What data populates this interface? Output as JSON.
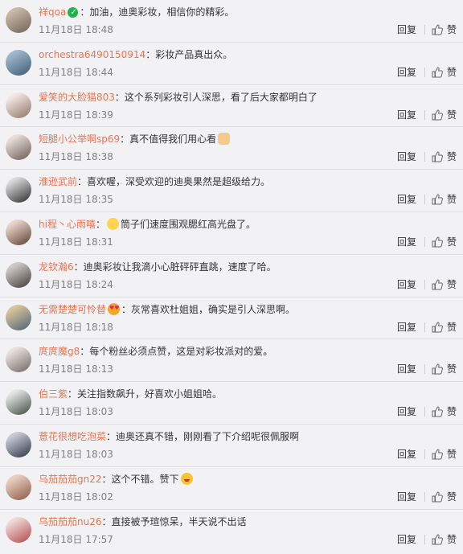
{
  "comments": [
    {
      "user": "祥qoa",
      "badge": true,
      "text": "加油，迪奥彩妆，相信你的精彩。",
      "date": "11月18日 18:48",
      "avatar": [
        "#c8b8a8",
        "#6f6258"
      ]
    },
    {
      "user": "orchestra6490150914",
      "text": "彩妆产品真出众。",
      "date": "11月18日 18:44",
      "avatar": [
        "#9fb7cc",
        "#3d5a73"
      ]
    },
    {
      "user": "爱笑的大脸猫803",
      "text": "这个系列彩妆引人深思，看了后大家都明白了",
      "date": "11月18日 18:39",
      "avatar": [
        "#f1e7e1",
        "#8e7367"
      ]
    },
    {
      "user": "短腿小公举啊sp69",
      "text": "真不值得我们用心看",
      "emoji": "face",
      "date": "11月18日 18:38",
      "avatar": [
        "#e5ddd6",
        "#6b5a52"
      ]
    },
    {
      "user": "淮逊武前",
      "text": "喜欢喔，深受欢迎的迪奥果然是超级给力。",
      "date": "11月18日 18:35",
      "avatar": [
        "#d9d9d9",
        "#2a2a2a"
      ]
    },
    {
      "user": "hi程丶心雨嘻",
      "text": "筒子们速度围观腮红高光盘了。",
      "emoji": "person",
      "date": "11月18日 18:31",
      "avatar": [
        "#e8d4c8",
        "#5b3f33"
      ]
    },
    {
      "user": "龙钦瀚6",
      "text": "迪奥彩妆让我滴小心脏砰砰直跳，速度了哈。",
      "date": "11月18日 18:24",
      "avatar": [
        "#cfc9c6",
        "#403a37"
      ]
    },
    {
      "user": "无需楚楚可怜替",
      "emoji": "heart-eyes",
      "text": "灰常喜欢杜姐姐，确实是引人深思啊。",
      "date": "11月18日 18:18",
      "avatar": [
        "#d8c49a",
        "#4b6178"
      ]
    },
    {
      "user": "庹庹魔g8",
      "text": "每个粉丝必须点赞，这是对彩妆派对的爱。",
      "date": "11月18日 18:13",
      "avatar": [
        "#e7e1dc",
        "#716560"
      ]
    },
    {
      "user": "伯三紫",
      "text": "关注指数飙升，好喜欢小姐姐哈。",
      "date": "11月18日 18:03",
      "avatar": [
        "#e2e6e2",
        "#3e4a40"
      ]
    },
    {
      "user": "薏花很想吃泡菜",
      "text": "迪奥还真不错，刚刚看了下介绍呢很佩服啊",
      "date": "11月18日 18:03",
      "avatar": [
        "#c5cad4",
        "#2c3342"
      ]
    },
    {
      "user": "乌茄茄茄gn22",
      "text": "这个不错。赞下",
      "emoji": "grin",
      "date": "11月18日 18:02",
      "avatar": [
        "#e9cfc0",
        "#8a5845"
      ]
    },
    {
      "user": "乌茄茄茄nu26",
      "text": "直接被予瑄惊呆，半天说不出话",
      "date": "11月18日 17:57",
      "avatar": [
        "#f0d8d8",
        "#b04848"
      ]
    }
  ],
  "actions": {
    "reply_label": "回复",
    "like_label": "赞"
  },
  "colors": {
    "username": "#eb7350",
    "meta": "#808080",
    "background": "#f2f2f5"
  }
}
